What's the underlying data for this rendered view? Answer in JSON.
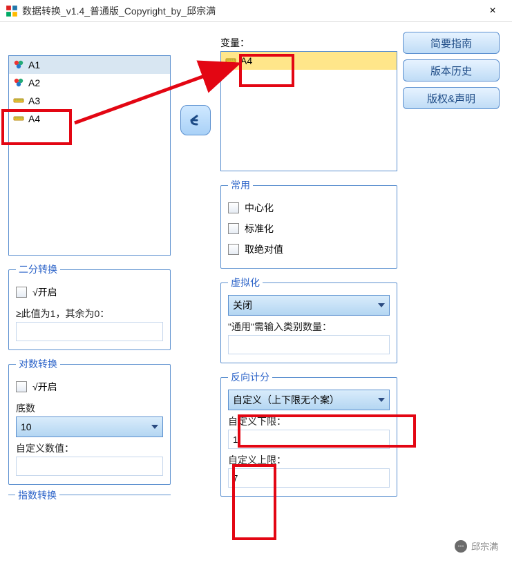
{
  "window": {
    "title": "数据转换_v1.4_普通版_Copyright_by_邱宗满",
    "close_glyph": "×"
  },
  "left_list": {
    "items": [
      {
        "label": "A1",
        "icon": "nominal",
        "selected": true
      },
      {
        "label": "A2",
        "icon": "nominal",
        "selected": false
      },
      {
        "label": "A3",
        "icon": "scale",
        "selected": false
      },
      {
        "label": "A4",
        "icon": "scale",
        "selected": false
      }
    ]
  },
  "variable_box": {
    "label": "变量：",
    "items": [
      {
        "label": "A4",
        "icon": "scale"
      }
    ]
  },
  "side_buttons": {
    "guide": "简要指南",
    "history": "版本历史",
    "copyright": "版权&声明"
  },
  "binary": {
    "legend": "二分转换",
    "enable_label": "√开启",
    "threshold_label": "≥此值为1，其余为0：",
    "threshold_value": ""
  },
  "log": {
    "legend": "对数转换",
    "enable_label": "√开启",
    "base_label": "底数",
    "base_value": "10",
    "custom_label": "自定义数值：",
    "custom_value": ""
  },
  "exp_legend": "指数转换",
  "common": {
    "legend": "常用",
    "center": "中心化",
    "standardize": "标准化",
    "abs": "取绝对值"
  },
  "dummy": {
    "legend": "虚拟化",
    "mode_value": "关闭",
    "note": "\"通用\"需输入类别数量：",
    "count_value": ""
  },
  "reverse": {
    "legend": "反向计分",
    "mode_value": "自定义（上下限无个案）",
    "lower_label": "自定义下限：",
    "lower_value": "1",
    "upper_label": "自定义上限：",
    "upper_value": "7"
  },
  "watermark": "邱宗满"
}
